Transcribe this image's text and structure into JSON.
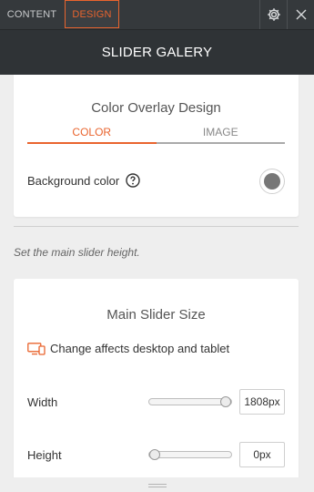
{
  "tabs": {
    "content_label": "CONTENT",
    "design_label": "DESIGN",
    "active": "design"
  },
  "icons": {
    "settings": "gear-icon",
    "close": "close-icon",
    "help": "question-circle-icon",
    "devices": "desktop-tablet-icon",
    "grip": "drag-grip-icon"
  },
  "header": {
    "title": "SLIDER GALERY"
  },
  "overlay_card": {
    "title": "Color Overlay Design",
    "tabs": [
      {
        "label": "COLOR",
        "active": true
      },
      {
        "label": "IMAGE",
        "active": false
      }
    ],
    "background_color_label": "Background color",
    "background_color_value": "#777777"
  },
  "hint": "Set the main slider height.",
  "size_card": {
    "title": "Main Slider Size",
    "notice": "Change affects desktop and tablet",
    "width_label": "Width",
    "width_value": "1808px",
    "width_slider_fraction": 1.0,
    "height_label": "Height",
    "height_value": "0px",
    "height_slider_fraction": 0.0
  },
  "colors": {
    "accent": "#e9642e",
    "topbar": "#35393c",
    "header": "#2f3336"
  }
}
